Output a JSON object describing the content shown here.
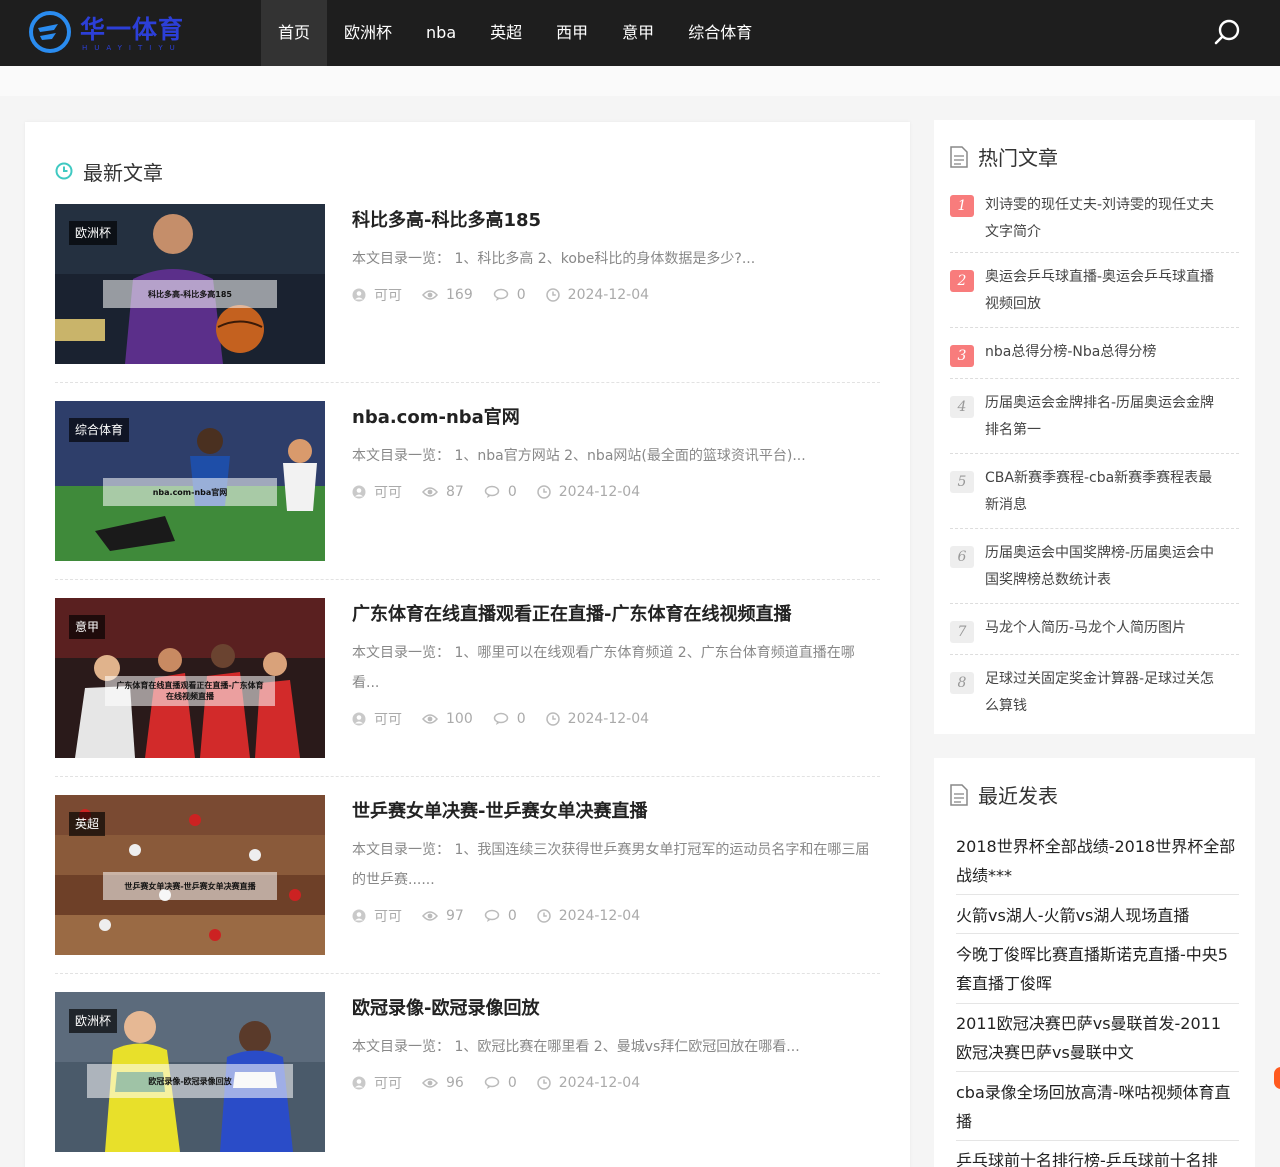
{
  "header": {
    "logo_text": "华一体育",
    "logo_sub": "HUAYITIYU",
    "nav": [
      "首页",
      "欧洲杯",
      "nba",
      "英超",
      "西甲",
      "意甲",
      "综合体育"
    ],
    "search_icon": "search-icon"
  },
  "main": {
    "section_title": "最新文章",
    "articles": [
      {
        "category": "欧洲杯",
        "thumb_caption": "科比多高-科比多高185",
        "title": "科比多高-科比多高185",
        "desc": "本文目录一览： 1、科比多高 2、kobe科比的身体数据是多少?...",
        "author": "可可",
        "views": "169",
        "comments": "0",
        "date": "2024-12-04"
      },
      {
        "category": "综合体育",
        "thumb_caption": "nba.com-nba官网",
        "title": "nba.com-nba官网",
        "desc": "本文目录一览： 1、nba官方网站 2、nba网站(最全面的篮球资讯平台)...",
        "author": "可可",
        "views": "87",
        "comments": "0",
        "date": "2024-12-04"
      },
      {
        "category": "意甲",
        "thumb_caption": "广东体育在线直播观看正在直播-广东体育在线视频直播",
        "title": "广东体育在线直播观看正在直播-广东体育在线视频直播",
        "desc": "本文目录一览： 1、哪里可以在线观看广东体育频道 2、广东台体育频道直播在哪看...",
        "author": "可可",
        "views": "100",
        "comments": "0",
        "date": "2024-12-04"
      },
      {
        "category": "英超",
        "thumb_caption": "世乒赛女单决赛-世乒赛女单决赛直播",
        "title": "世乒赛女单决赛-世乒赛女单决赛直播",
        "desc": "本文目录一览： 1、我国连续三次获得世乒赛男女单打冠军的运动员名字和在哪三届的世乒赛......",
        "author": "可可",
        "views": "97",
        "comments": "0",
        "date": "2024-12-04"
      },
      {
        "category": "欧洲杯",
        "thumb_caption": "欧冠录像-欧冠录像回放",
        "title": "欧冠录像-欧冠录像回放",
        "desc": "本文目录一览： 1、欧冠比赛在哪里看 2、曼城vs拜仁欧冠回放在哪看...",
        "author": "可可",
        "views": "96",
        "comments": "0",
        "date": "2024-12-04"
      }
    ]
  },
  "sidebar": {
    "hot_title": "热门文章",
    "hot": [
      {
        "num": "1",
        "text": "刘诗雯的现任丈夫-刘诗雯的现任丈夫文字简介"
      },
      {
        "num": "2",
        "text": "奥运会乒乓球直播-奥运会乒乓球直播视频回放"
      },
      {
        "num": "3",
        "text": "nba总得分榜-Nba总得分榜"
      },
      {
        "num": "4",
        "text": "历届奥运会金牌排名-历届奥运会金牌排名第一"
      },
      {
        "num": "5",
        "text": "CBA新赛季赛程-cba新赛季赛程表最新消息"
      },
      {
        "num": "6",
        "text": "历届奥运会中国奖牌榜-历届奥运会中国奖牌榜总数统计表"
      },
      {
        "num": "7",
        "text": "马龙个人简历-马龙个人简历图片"
      },
      {
        "num": "8",
        "text": "足球过关固定奖金计算器-足球过关怎么算钱"
      }
    ],
    "recent_title": "最近发表",
    "recent": [
      "2018世界杯全部战绩-2018世界杯全部战绩***",
      "火箭vs湖人-火箭vs湖人现场直播",
      "今晚丁俊晖比赛直播斯诺克直播-中央5套直播丁俊晖",
      "2011欧冠决赛巴萨vs曼联首发-2011欧冠决赛巴萨vs曼联中文",
      "cba录像全场回放高清-咪咕视频体育直播",
      "乒乓球前十名排行榜-乒乓球前十名排"
    ]
  },
  "colors": {
    "header_bg": "#1e1e1e",
    "logo_blue": "#2c3fd8",
    "clock_teal": "#3fc9c2",
    "hot_red": "#f87c7c"
  }
}
